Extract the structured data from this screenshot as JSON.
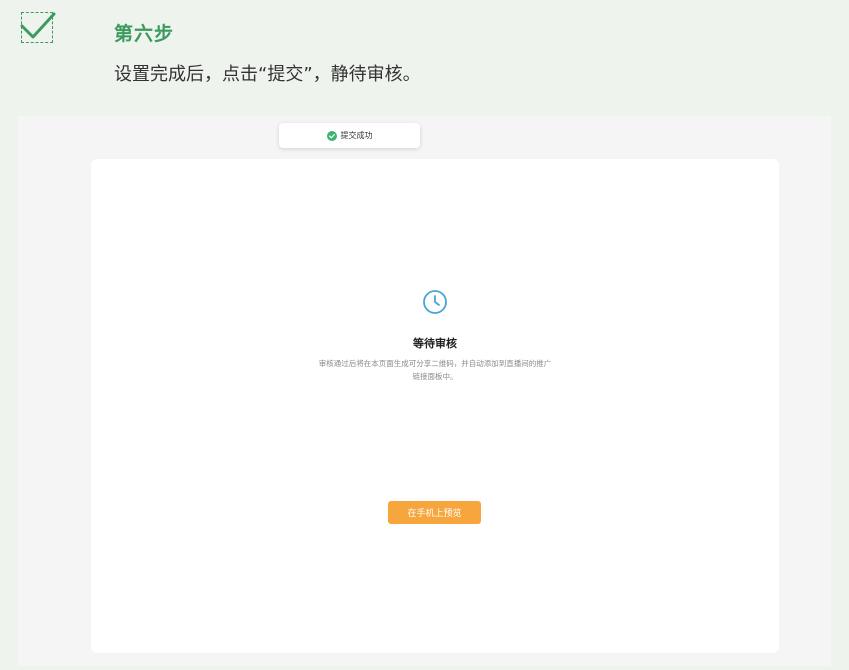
{
  "step": {
    "title": "第六步",
    "description": "设置完成后，点击“提交”，静待审核。"
  },
  "toast": {
    "icon": "check-circle-icon",
    "text": "提交成功",
    "color": "#3cb371"
  },
  "card": {
    "icon": "clock-icon",
    "icon_color": "#4aa3d8",
    "title": "等待审核",
    "description": "审核通过后将在本页面生成可分享二维码，并自动添加到直播间的推广链接面板中。",
    "button_label": "在手机上预览",
    "button_color": "#f7a63e"
  },
  "colors": {
    "accent": "#3c9a5f",
    "background": "#eef3ee"
  }
}
